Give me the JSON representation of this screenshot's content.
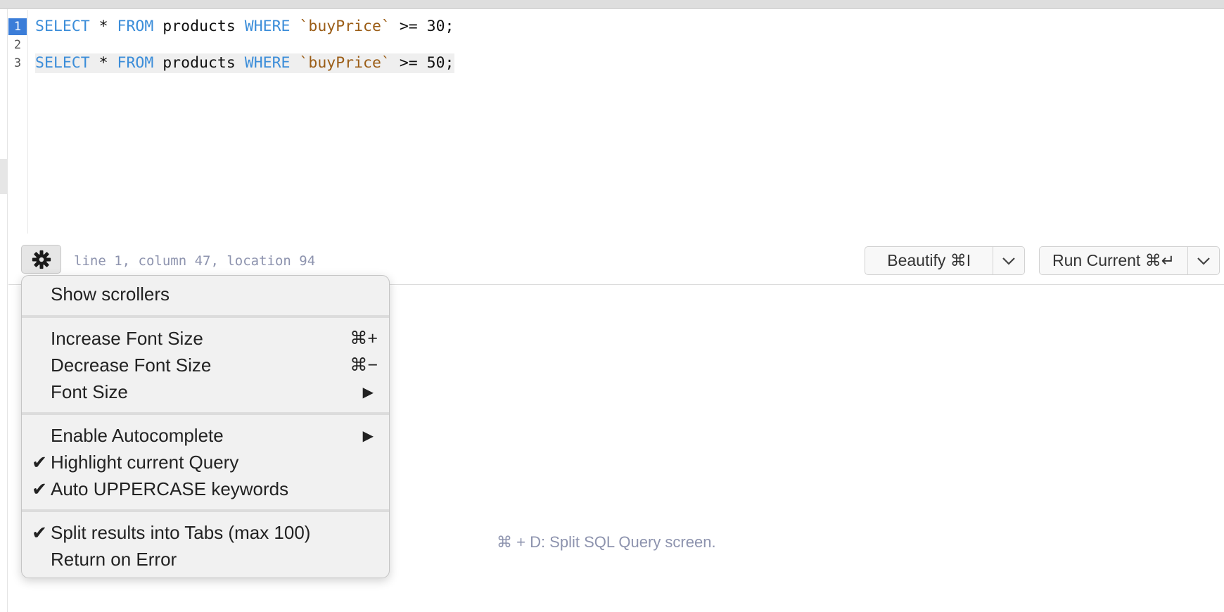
{
  "editor": {
    "line_numbers": [
      "1",
      "2",
      "3"
    ],
    "lines": [
      {
        "parts": [
          {
            "text": "SELECT",
            "kind": "kw"
          },
          {
            "text": " * ",
            "kind": "plain"
          },
          {
            "text": "FROM",
            "kind": "kw"
          },
          {
            "text": " products ",
            "kind": "plain"
          },
          {
            "text": "WHERE",
            "kind": "kw"
          },
          {
            "text": " ",
            "kind": "plain"
          },
          {
            "text": "`buyPrice`",
            "kind": "id"
          },
          {
            "text": " >= 30;",
            "kind": "plain"
          }
        ]
      },
      {
        "parts": [
          {
            "text": "SELECT",
            "kind": "kw"
          },
          {
            "text": " * ",
            "kind": "plain"
          },
          {
            "text": "FROM",
            "kind": "kw"
          },
          {
            "text": " products ",
            "kind": "plain"
          },
          {
            "text": "WHERE",
            "kind": "kw"
          },
          {
            "text": " ",
            "kind": "plain"
          },
          {
            "text": "`buyPrice`",
            "kind": "id"
          },
          {
            "text": " >= 50;",
            "kind": "plain"
          }
        ]
      }
    ],
    "colors": {
      "keyword": "#3b8dd9",
      "identifier": "#9b5d16",
      "active_line_number": "#3b7dd8"
    }
  },
  "statusbar": {
    "settings_icon": "gear-icon",
    "position_text": "line 1, column 47, location 94",
    "beautify_label": "Beautify ⌘I",
    "run_label": "Run Current ⌘↵",
    "dropdown_icon": "chevron-down-icon"
  },
  "menu": {
    "show_scrollers": "Show scrollers",
    "increase_font": {
      "label": "Increase Font Size",
      "shortcut": "⌘+"
    },
    "decrease_font": {
      "label": "Decrease Font Size",
      "shortcut": "⌘−"
    },
    "font_size": {
      "label": "Font Size",
      "submenu": "▶"
    },
    "enable_autocomplete": {
      "label": "Enable Autocomplete",
      "submenu": "▶"
    },
    "highlight_query": {
      "label": "Highlight current Query",
      "check": "✔"
    },
    "auto_uppercase": {
      "label": "Auto UPPERCASE keywords",
      "check": "✔"
    },
    "split_tabs": {
      "label": "Split results into Tabs (max 100)",
      "check": "✔"
    },
    "return_on_error": "Return on Error"
  },
  "results": {
    "hint": "⌘ + D: Split SQL Query screen."
  }
}
